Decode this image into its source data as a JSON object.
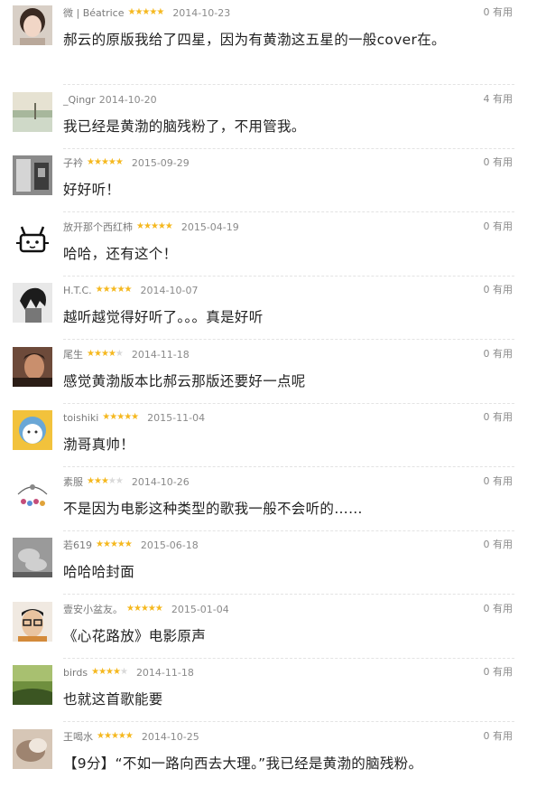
{
  "useful_suffix": "有用",
  "comments": [
    {
      "user": "微 | Béatrice",
      "rating": 5,
      "date": "2014-10-23",
      "useful": "0",
      "text": "郝云的原版我给了四星，因为有黄渤这五星的一般cover在。",
      "avatar_icon": "girl-portrait-avatar",
      "avatar_colors": [
        "#d8cfc6",
        "#3a2a22",
        "#f1d6c6"
      ]
    },
    {
      "user": "_Qingr",
      "rating": 0,
      "date": "2014-10-20",
      "useful": "4",
      "text": "我已经是黄渤的脑残粉了，不用管我。",
      "avatar_icon": "beach-photo-avatar",
      "avatar_colors": [
        "#cfd9c8",
        "#a7b79c",
        "#e6e2d2"
      ]
    },
    {
      "user": "子衿",
      "rating": 5,
      "date": "2015-09-29",
      "useful": "0",
      "text": "好好听！",
      "avatar_icon": "room-photo-avatar",
      "avatar_colors": [
        "#8a8a8a",
        "#d5d5d5",
        "#3c3c3c"
      ]
    },
    {
      "user": "放开那个西红柿",
      "rating": 5,
      "date": "2015-04-19",
      "useful": "0",
      "text": "哈哈，还有这个！",
      "avatar_icon": "cartoon-rabbit-avatar",
      "avatar_colors": [
        "#ffffff",
        "#111111",
        "#111111"
      ]
    },
    {
      "user": "H.T.C.",
      "rating": 5,
      "date": "2014-10-07",
      "useful": "0",
      "text": "越听越觉得好听了。。。真是好听",
      "avatar_icon": "anime-character-avatar",
      "avatar_colors": [
        "#e8e8e8",
        "#1c1c1c",
        "#777777"
      ]
    },
    {
      "user": "尾生",
      "rating": 4,
      "date": "2014-11-18",
      "useful": "0",
      "text": "感觉黄渤版本比郝云那版还要好一点呢",
      "avatar_icon": "man-portrait-avatar",
      "avatar_colors": [
        "#6d4a3a",
        "#c98f6d",
        "#2b1d16"
      ]
    },
    {
      "user": "toishiki",
      "rating": 5,
      "date": "2015-11-04",
      "useful": "0",
      "text": "渤哥真帅！",
      "avatar_icon": "cartoon-face-avatar",
      "avatar_colors": [
        "#f2c23c",
        "#6aa7d6",
        "#ffffff"
      ]
    },
    {
      "user": "素服",
      "rating": 3,
      "date": "2014-10-26",
      "useful": "0",
      "text": "不是因为电影这种类型的歌我一般不会听的……",
      "avatar_icon": "doodle-avatar",
      "avatar_colors": [
        "#ffffff",
        "#c44d7a",
        "#5a8dd6"
      ]
    },
    {
      "user": "若619",
      "rating": 5,
      "date": "2015-06-18",
      "useful": "0",
      "text": "哈哈哈封面",
      "avatar_icon": "hands-photo-avatar",
      "avatar_colors": [
        "#9a9a9a",
        "#cfcfcf",
        "#5e5e5e"
      ]
    },
    {
      "user": "壹安小盆友。",
      "rating": 5,
      "date": "2015-01-04",
      "useful": "0",
      "text": "《心花路放》电影原声",
      "avatar_icon": "glasses-man-avatar",
      "avatar_colors": [
        "#f0e9e1",
        "#1d1d1d",
        "#d38a3a"
      ]
    },
    {
      "user": "birds",
      "rating": 4,
      "date": "2014-11-18",
      "useful": "0",
      "text": "也就这首歌能要",
      "avatar_icon": "grass-field-avatar",
      "avatar_colors": [
        "#6f8f3e",
        "#a8c070",
        "#3b5522"
      ]
    },
    {
      "user": "王喝水",
      "rating": 5,
      "date": "2014-10-25",
      "useful": "0",
      "text": "【9分】“不如一路向西去大理。”我已经是黄渤的脑残粉。",
      "avatar_icon": "blurred-photo-avatar",
      "avatar_colors": [
        "#d6c6b6",
        "#9e8470",
        "#efe6dc"
      ]
    }
  ]
}
